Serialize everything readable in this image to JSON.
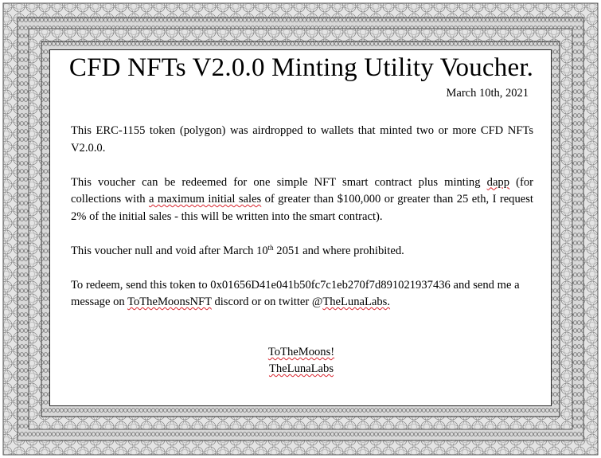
{
  "voucher": {
    "title": "CFD NFTs V2.0.0 Minting Utility Voucher.",
    "date": "March 10th, 2021",
    "paragraph1": "This ERC-1155 token (polygon) was airdropped to wallets that minted two or more CFD NFTs V2.0.0.",
    "paragraph2": {
      "part1": "This voucher can be redeemed for one simple NFT smart contract plus minting ",
      "dapp": "dapp",
      "part2": " (for collections with ",
      "max_sales": "a maximum initial sales",
      "part3": " of greater than $100,000 or greater than 25 eth, I request 2% of the initial sales - this will be written into the smart contract)."
    },
    "paragraph3": {
      "part1": "This voucher null and void after March 10",
      "superscript": "th",
      "part2": " 2051 and where prohibited."
    },
    "paragraph4": {
      "part1": "To redeem, send this token to 0x01656D41e041b50fc7c1eb270f7d891021937436 and send me a message on ",
      "discord_name": "ToTheMoonsNFT",
      "part2": " discord or on twitter @",
      "twitter_handle": "TheLunaLabs."
    },
    "signature": {
      "line1": "ToTheMoons!",
      "line2": "TheLunaLabs"
    }
  },
  "colors": {
    "border_pattern": "#6b6b6b",
    "spellcheck_underline": "#d9232d",
    "background": "#ffffff"
  }
}
